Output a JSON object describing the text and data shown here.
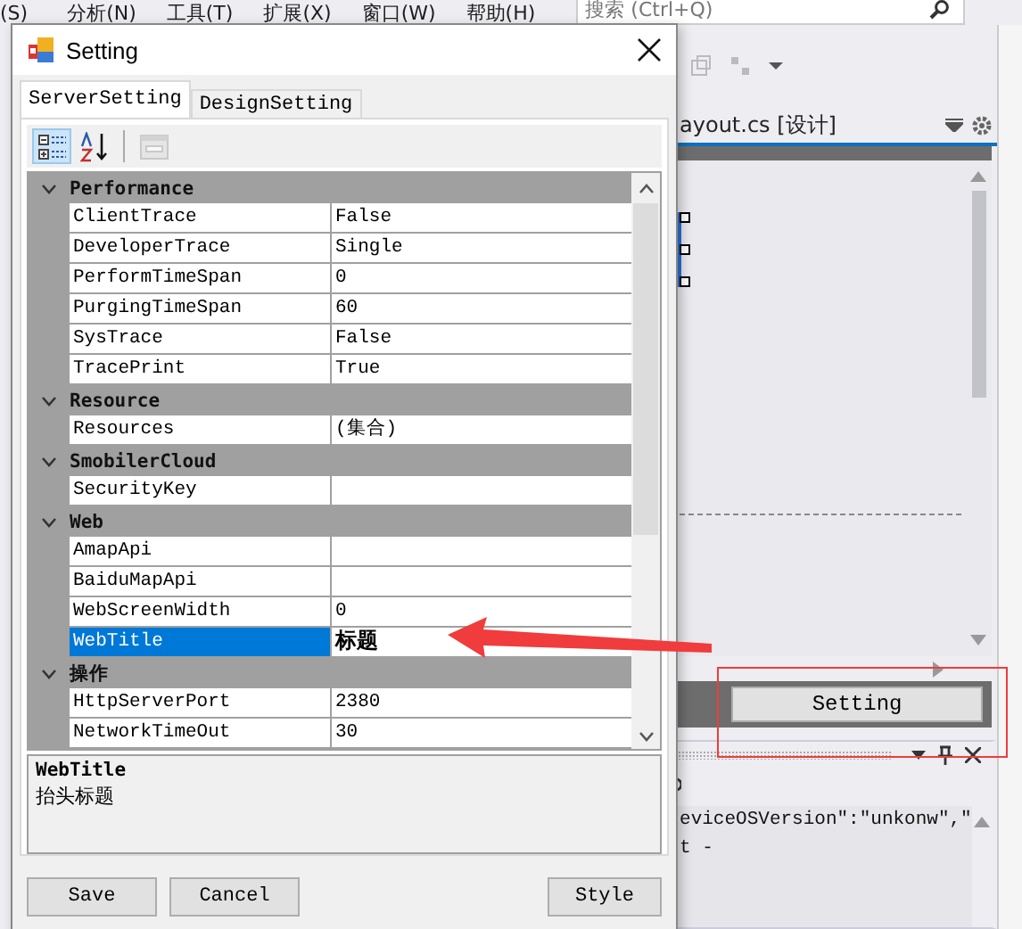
{
  "menu_bar": {
    "items": [
      "(S)",
      "分析(N)",
      "工具(T)",
      "扩展(X)",
      "窗口(W)",
      "帮助(H)"
    ],
    "search": {
      "placeholder": "搜索 (Ctrl+Q)"
    }
  },
  "designer": {
    "tab_title": "ayout.cs [设计]",
    "button": "Setting"
  },
  "output": {
    "lines": [
      "eviceOSVersion\":\"unkonw\",\"",
      "t -"
    ]
  },
  "dialog": {
    "title": "Setting",
    "tabs": [
      {
        "label": "ServerSetting",
        "selected": true
      },
      {
        "label": "DesignSetting",
        "selected": false
      }
    ],
    "toolbar": [
      {
        "kind": "categorized",
        "selected": true,
        "disabled": false
      },
      {
        "kind": "alphabetical",
        "selected": false,
        "disabled": false
      },
      {
        "kind": "pages",
        "selected": false,
        "disabled": true
      }
    ],
    "categories": [
      {
        "name": "Performance",
        "expanded": true,
        "properties": [
          {
            "name": "ClientTrace",
            "value": "False",
            "selected": false,
            "modified": false
          },
          {
            "name": "DeveloperTrace",
            "value": "Single",
            "selected": false,
            "modified": false
          },
          {
            "name": "PerformTimeSpan",
            "value": "0",
            "selected": false,
            "modified": false
          },
          {
            "name": "PurgingTimeSpan",
            "value": "60",
            "selected": false,
            "modified": false
          },
          {
            "name": "SysTrace",
            "value": "False",
            "selected": false,
            "modified": false
          },
          {
            "name": "TracePrint",
            "value": "True",
            "selected": false,
            "modified": false
          }
        ]
      },
      {
        "name": "Resource",
        "expanded": true,
        "properties": [
          {
            "name": "Resources",
            "value": "(集合)",
            "selected": false,
            "modified": false
          }
        ]
      },
      {
        "name": "SmobilerCloud",
        "expanded": true,
        "properties": [
          {
            "name": "SecurityKey",
            "selected": false,
            "modified": false
          }
        ]
      },
      {
        "name": "Web",
        "expanded": true,
        "properties": [
          {
            "name": "AmapApi",
            "selected": false,
            "modified": false
          },
          {
            "name": "BaiduMapApi",
            "selected": false,
            "modified": false
          },
          {
            "name": "WebScreenWidth",
            "value": "0",
            "selected": false,
            "modified": false
          },
          {
            "name": "WebTitle",
            "value": "标题",
            "selected": true,
            "modified": true
          }
        ]
      },
      {
        "name": "操作",
        "expanded": true,
        "properties": [
          {
            "name": "HttpServerPort",
            "value": "2380",
            "selected": false,
            "modified": false
          },
          {
            "name": "NetworkTimeOut",
            "value": "30",
            "selected": false,
            "modified": false
          }
        ]
      }
    ],
    "description": {
      "title": "WebTitle",
      "text": "抬头标题"
    },
    "buttons": [
      "Save",
      "Cancel",
      "Style"
    ]
  }
}
